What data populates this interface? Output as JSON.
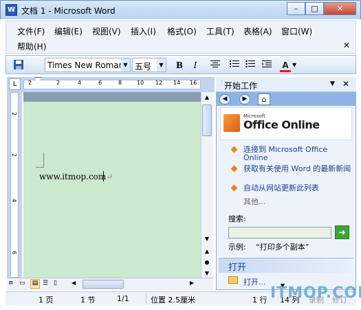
{
  "window": {
    "title": "文档 1 - Microsoft Word",
    "icon": "W"
  },
  "caption_buttons": {
    "minimize": "–",
    "maximize": "□",
    "close": "✕"
  },
  "menus": [
    "文件(F)",
    "编辑(E)",
    "视图(V)",
    "插入(I)",
    "格式(O)",
    "工具(T)",
    "表格(A)",
    "窗口(W)",
    "帮助(H)"
  ],
  "menu_close": "✕",
  "toolbar": {
    "font_name": "Times New Roman",
    "font_size": "五号",
    "bold": "B",
    "italic": "I",
    "font_color": "A"
  },
  "ruler": {
    "marks": [
      "2",
      "2",
      "4",
      "6",
      "8",
      "10",
      "12",
      "14",
      "16"
    ]
  },
  "vruler": {
    "marks": [
      "2",
      "2",
      "4",
      "6"
    ]
  },
  "document": {
    "text": "www.itmop.com",
    "para_mark": "↵"
  },
  "task_pane": {
    "title": "开始工作",
    "logo_small": "Microsoft",
    "logo_big": "Office Online",
    "links": [
      "连接到 Microsoft Office Online",
      "获取有关使用 Word 的最新新闻",
      "自动从网站更新此列表"
    ],
    "more": "其他...",
    "search_label": "搜索:",
    "search_value": "",
    "example_label": "示例:",
    "example_text": "“打印多个副本”",
    "open_heading": "打开",
    "open_item": "打开..."
  },
  "status": {
    "page": "1 页",
    "section": "1 节",
    "pages": "1/1",
    "position": "位置 2.5厘米",
    "line": "1 行",
    "col": "14 列",
    "rec": "录制",
    "rev": "修订"
  },
  "watermark": "ITMOP.COM",
  "colors": {
    "accent": "#2b5bb4",
    "page_bg": "#cce8cf",
    "link": "#1c3f94"
  }
}
